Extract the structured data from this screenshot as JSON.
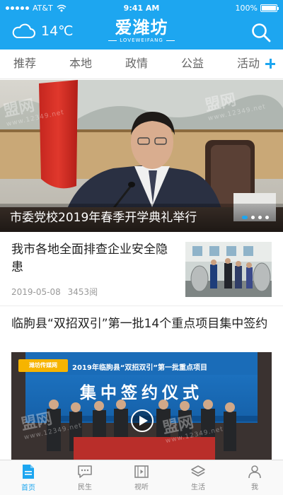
{
  "status_bar": {
    "carrier": "AT&T",
    "time": "9:41 AM",
    "battery": "100%",
    "battery_level": 1.0
  },
  "header": {
    "weather_icon": "cloud-icon",
    "temperature": "14℃",
    "logo_text": "爱潍坊",
    "logo_subtext": "LOVEWEIFANG",
    "search_icon": "search-icon"
  },
  "tabs": [
    {
      "label": "推荐",
      "active": true
    },
    {
      "label": "本地",
      "active": false
    },
    {
      "label": "政情",
      "active": false
    },
    {
      "label": "公益",
      "active": false
    },
    {
      "label": "活动",
      "active": false
    }
  ],
  "hero": {
    "caption": "市委党校2019年春季开学典礼举行",
    "slide_count": 4,
    "active_slide": 1
  },
  "articles": [
    {
      "title": "我市各地全面排查企业安全隐患",
      "date": "2019-05-08",
      "views": "3453阅"
    },
    {
      "title": "临朐县“双招双引”第一批14个重点项目集中签约",
      "image_banner_text": "2019年临朐县“双招双引”第一批重点项目",
      "image_headline": "集中签约仪式",
      "image_logo": "潍坊传媒网",
      "media_type": "video"
    }
  ],
  "watermark": {
    "text": "盟网",
    "url": "www.12349.net"
  },
  "bottom_nav": [
    {
      "label": "首页",
      "icon": "home-doc-icon",
      "active": true
    },
    {
      "label": "民生",
      "icon": "chat-bubble-icon",
      "active": false
    },
    {
      "label": "视听",
      "icon": "film-icon",
      "active": false
    },
    {
      "label": "生活",
      "icon": "layers-icon",
      "active": false
    },
    {
      "label": "我",
      "icon": "person-icon",
      "active": false
    }
  ],
  "colors": {
    "brand": "#1da6f0",
    "inactive": "#888888"
  }
}
